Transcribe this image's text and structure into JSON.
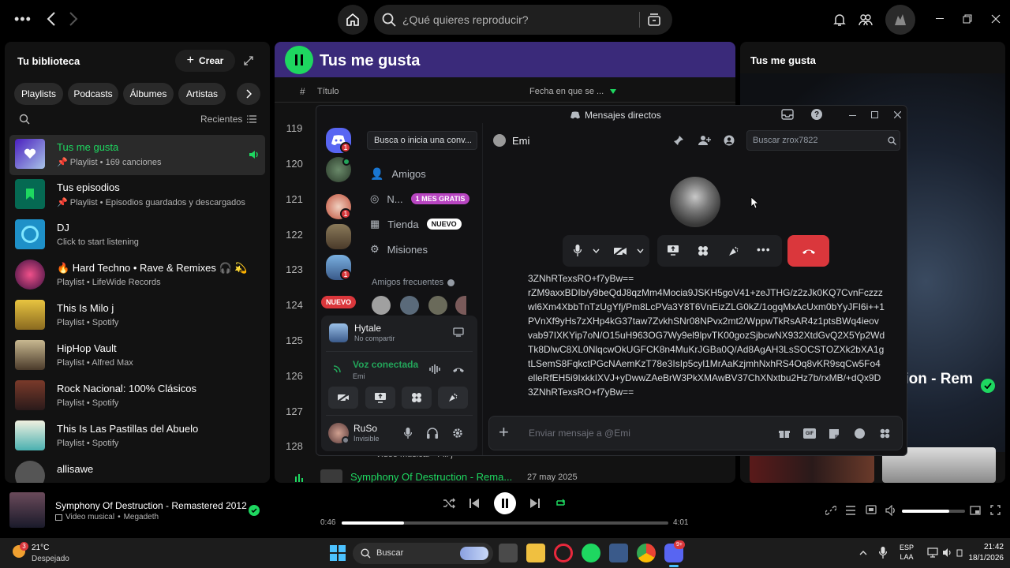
{
  "topbar": {
    "search_placeholder": "¿Qué quieres reproducir?"
  },
  "sidebar": {
    "title": "Tu biblioteca",
    "create_label": "Crear",
    "chips": [
      "Playlists",
      "Podcasts",
      "Álbumes",
      "Artistas"
    ],
    "sort_label": "Recientes",
    "items": [
      {
        "title": "Tus me gusta",
        "subtitle": "Playlist • 169 canciones",
        "color": "#6f3fdc"
      },
      {
        "title": "Tus episodios",
        "subtitle": "Playlist • Episodios guardados y descargados",
        "color": "#1a7a4c"
      },
      {
        "title": "DJ",
        "subtitle": "Click to start listening",
        "color": "#1e90c8"
      },
      {
        "title": "🔥 Hard Techno • Rave & Remixes 🎧 💫",
        "subtitle": "Playlist • LifeWide Records",
        "color": "#b0306a"
      },
      {
        "title": "This Is Milo j",
        "subtitle": "Playlist • Spotify",
        "color": "#e8c440"
      },
      {
        "title": "HipHop Vault",
        "subtitle": "Playlist • Alfred Max",
        "color": "#6a5a3a"
      },
      {
        "title": "Rock Nacional: 100% Clásicos",
        "subtitle": "Playlist • Spotify",
        "color": "#5a2a2a"
      },
      {
        "title": "This Is Las Pastillas del Abuelo",
        "subtitle": "Playlist • Spotify",
        "color": "#4ab0b0"
      },
      {
        "title": "allisawe",
        "subtitle": "",
        "color": "#444"
      }
    ]
  },
  "main": {
    "title": "Tus me gusta",
    "col_hash": "#",
    "col_title": "Título",
    "col_date": "Fecha en que se ...",
    "row_numbers": [
      "119",
      "120",
      "121",
      "122",
      "123",
      "124",
      "125",
      "126",
      "127",
      "128"
    ],
    "bottom_row_meta": "Video musical • Fili j",
    "playing_track": "Symphony Of Destruction - Rema...",
    "playing_date": "27 may 2025"
  },
  "right": {
    "title": "Tus me gusta",
    "track_partial": "tion - Rem"
  },
  "discord": {
    "window_title": "Mensajes directos",
    "search_dm": "Busca o inicia una conv...",
    "nav": {
      "friends": "Amigos",
      "nitro": "N...",
      "nitro_badge": "1 MES GRATIS",
      "shop": "Tienda",
      "shop_badge": "NUEVO",
      "quests": "Misiones"
    },
    "frequent_label": "Amigos frecuentes",
    "new_label": "NUEVO",
    "game": {
      "name": "Hytale",
      "status": "No compartir"
    },
    "voice": {
      "status": "Voz conectada",
      "user": "Emi"
    },
    "me": {
      "name": "RuSo",
      "status": "Invisible"
    },
    "channel_name": "Emi",
    "search_placeholder": "Buscar zrox7822",
    "message_lines": [
      "3ZNhRTexsRO+f7yBw==",
      "rZM9axxBDIb/y9beQdJ8qzMm4Mocia9JSKH5goV41+zeJTHG/z2zJk0KQ7CvnFczzz",
      "wl6Xm4XbbTnTzUgYfj/Pm8LcPVa3Y8T6VnEizZLG0kZ/1ogqMxAcUxm0bYyJFI6i++1",
      "PVnXf9yHs7zXHp4kG37taw7ZvkhSNr08NPvx2mt2/WppwTkRsAR4z1ptsBWq4ieov",
      "vab97IXKYip7oN/O15uH963OG7Wy9el9lpvTK00gozSjbcwNX932XtdGvQ2X5Yp2Wd",
      "Tk8DlwC8XL0NlqcwOkUGFCK8n4MuKrJGBa0Q/Ad8AgAH3LsSOCSTOZXk2bXA1g",
      "tLSemS8FqkctPGcNAemKzT78e3IsIp5cyl1MrAaKzjmhNxhRS4Oq8vKR9sqCw5Fo4",
      "elleRfEH5i9IxkkIXVJ+yDwwZAeBrW3PkXMAwBV37ChXNxtbu2Hz7b/rxMB/+dQx9D",
      "3ZNhRTexsRO+f7yBw=="
    ],
    "composer_placeholder": "Enviar mensaje a @Emi"
  },
  "player": {
    "track": "Symphony Of Destruction - Remastered 2012",
    "type": "Video musical",
    "artist": "Megadeth",
    "elapsed": "0:46",
    "total": "4:01",
    "progress": 0.19,
    "volume": 0.75
  },
  "taskbar": {
    "weather_temp": "21°C",
    "weather_desc": "Despejado",
    "weather_badge": "3",
    "search_label": "Buscar",
    "lang1": "ESP",
    "lang2": "LAA",
    "time": "21:42",
    "date": "18/1/2026",
    "discord_badge": "9+"
  }
}
